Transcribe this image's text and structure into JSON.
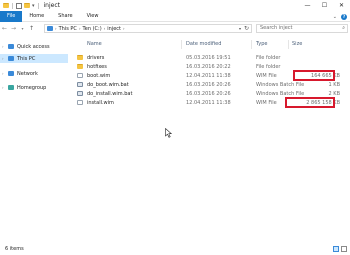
{
  "window": {
    "title": "inject"
  },
  "window_controls": {
    "minimize": "—",
    "maximize": "☐",
    "close": "✕"
  },
  "ribbon": {
    "tabs": [
      {
        "label": "File"
      },
      {
        "label": "Home"
      },
      {
        "label": "Share"
      },
      {
        "label": "View"
      }
    ]
  },
  "address": {
    "crumbs": [
      "This PC",
      "Ten (C:)",
      "inject"
    ]
  },
  "search": {
    "placeholder": "Search inject"
  },
  "nav": {
    "items": [
      {
        "label": "Quick access"
      },
      {
        "label": "This PC"
      },
      {
        "label": "Network"
      },
      {
        "label": "Homegroup"
      }
    ]
  },
  "columns": {
    "name": "Name",
    "date": "Date modified",
    "type": "Type",
    "size": "Size"
  },
  "files": [
    {
      "name": "drivers",
      "date": "05.03.2016 19:51",
      "type": "File folder",
      "size": "",
      "icon": "folder-icon"
    },
    {
      "name": "hotfixes",
      "date": "16.03.2016 20:22",
      "type": "File folder",
      "size": "",
      "icon": "folder-icon"
    },
    {
      "name": "boot.wim",
      "date": "12.04.2011 11:38",
      "type": "WIM File",
      "size": "164 665 KB",
      "icon": "wim-file-icon"
    },
    {
      "name": "do_boot.wim.bat",
      "date": "16.03.2016 20:26",
      "type": "Windows Batch File",
      "size": "1 KB",
      "icon": "batch-file-icon"
    },
    {
      "name": "do_install.wim.bat",
      "date": "16.03.2016 20:26",
      "type": "Windows Batch File",
      "size": "2 KB",
      "icon": "batch-file-icon"
    },
    {
      "name": "install.wim",
      "date": "12.04.2011 11:38",
      "type": "WIM File",
      "size": "2 865 158 KB",
      "icon": "wim-file-icon"
    }
  ],
  "status": {
    "text": "6 items"
  },
  "colors": {
    "accent": "#1979ca",
    "selection": "#cce8ff",
    "highlight": "#d7192d"
  }
}
